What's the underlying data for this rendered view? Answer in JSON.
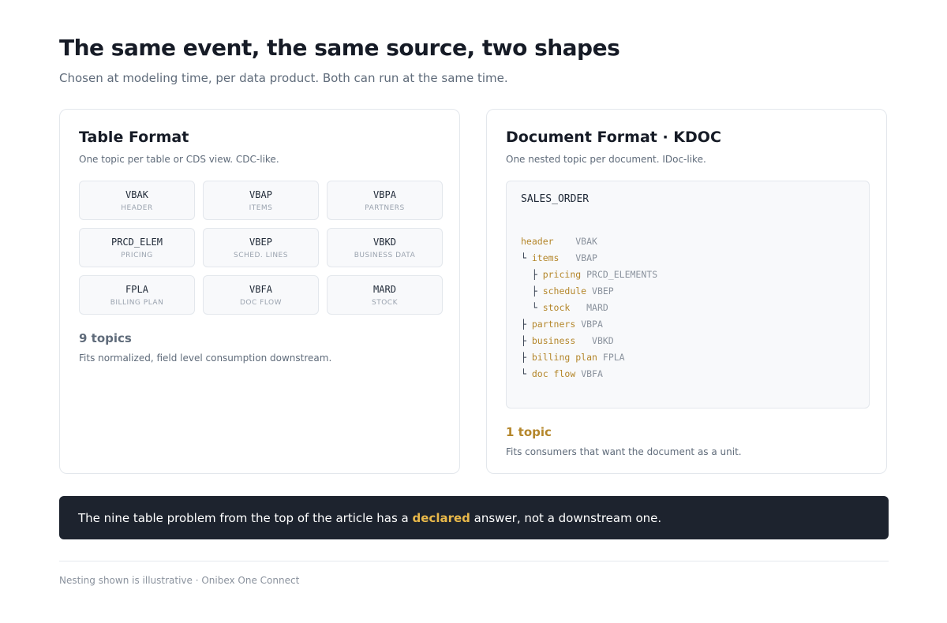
{
  "header": {
    "title": "The same event, the same source, two shapes",
    "subtitle": "Chosen at modeling time, per data product. Both can run at the same time."
  },
  "table_format": {
    "title": "Table Format",
    "description": "One topic per table or CDS view. CDC-like.",
    "tiles": [
      {
        "code": "VBAK",
        "label": "HEADER"
      },
      {
        "code": "VBAP",
        "label": "ITEMS"
      },
      {
        "code": "VBPA",
        "label": "PARTNERS"
      },
      {
        "code": "PRCD_ELEM",
        "label": "PRICING"
      },
      {
        "code": "VBEP",
        "label": "SCHED. LINES"
      },
      {
        "code": "VBKD",
        "label": "BUSINESS DATA"
      },
      {
        "code": "FPLA",
        "label": "BILLING PLAN"
      },
      {
        "code": "VBFA",
        "label": "DOC FLOW"
      },
      {
        "code": "MARD",
        "label": "STOCK"
      }
    ],
    "count": "9 topics",
    "note": "Fits normalized, field level consumption downstream."
  },
  "document_format": {
    "title": "Document Format · KDOC",
    "description": "One nested topic per document. IDoc-like.",
    "root": "SALES_ORDER",
    "tree": [
      {
        "prefix": "",
        "name": "header",
        "pad": "    ",
        "table": "VBAK"
      },
      {
        "prefix": "└ ",
        "name": "items",
        "pad": "   ",
        "table": "VBAP"
      },
      {
        "prefix": "  ├ ",
        "name": "pricing",
        "pad": " ",
        "table": "PRCD_ELEMENTS"
      },
      {
        "prefix": "  ├ ",
        "name": "schedule",
        "pad": " ",
        "table": "VBEP"
      },
      {
        "prefix": "  └ ",
        "name": "stock",
        "pad": "   ",
        "table": "MARD"
      },
      {
        "prefix": "├ ",
        "name": "partners",
        "pad": " ",
        "table": "VBPA"
      },
      {
        "prefix": "├ ",
        "name": "business",
        "pad": "   ",
        "table": "VBKD"
      },
      {
        "prefix": "├ ",
        "name": "billing plan",
        "pad": " ",
        "table": "FPLA"
      },
      {
        "prefix": "└ ",
        "name": "doc flow",
        "pad": " ",
        "table": "VBFA"
      }
    ],
    "count": "1 topic",
    "note": "Fits consumers that want the document as a unit."
  },
  "banner": {
    "before": "The nine table problem from the top of the article has a ",
    "emphasis": "declared",
    "after": " answer, not a downstream one."
  },
  "footer": {
    "text": "Nesting shown is illustrative · Onibex One Connect"
  },
  "colors": {
    "accent": "#b4862a",
    "banner_bg": "#1d232e",
    "banner_emphasis": "#e8b84a"
  }
}
